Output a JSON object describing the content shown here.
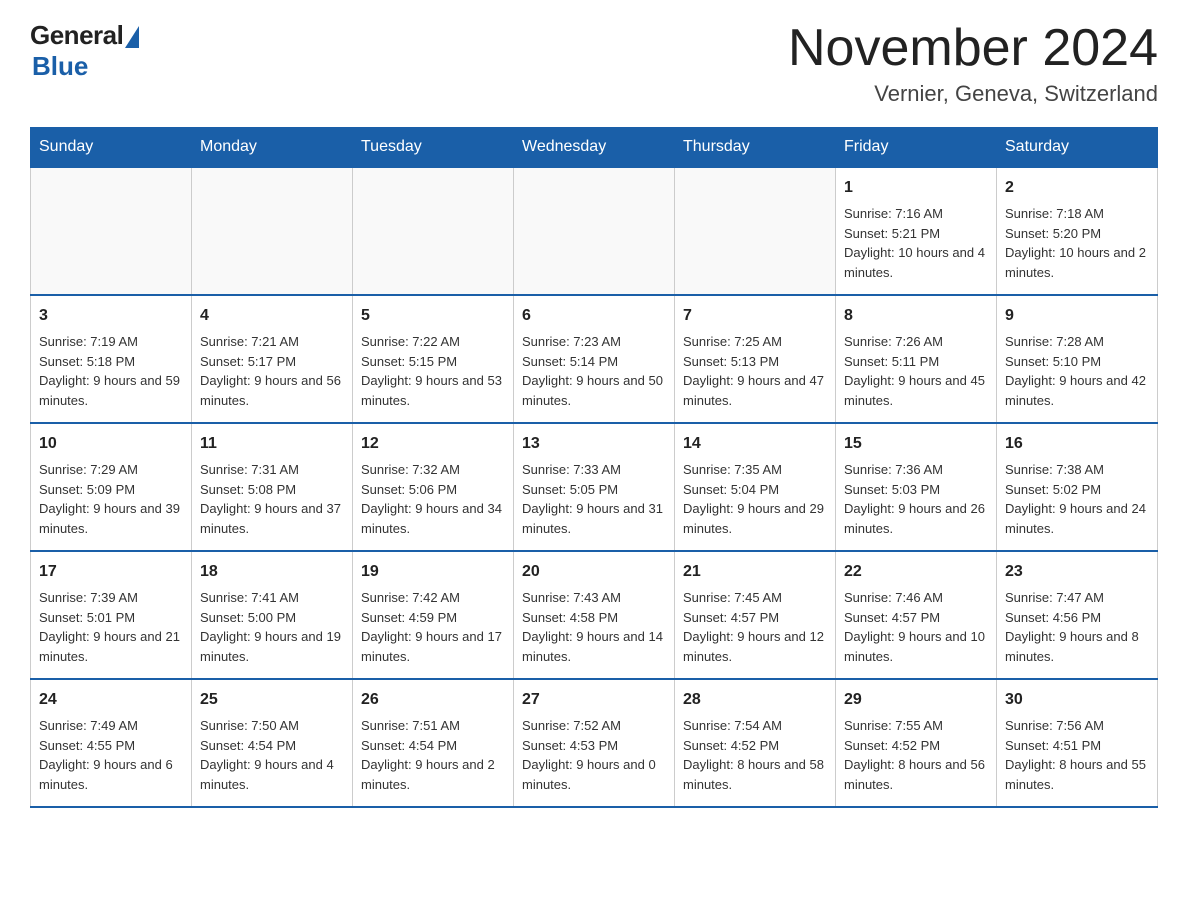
{
  "header": {
    "logo_general": "General",
    "logo_blue": "Blue",
    "title": "November 2024",
    "subtitle": "Vernier, Geneva, Switzerland"
  },
  "days_of_week": [
    "Sunday",
    "Monday",
    "Tuesday",
    "Wednesday",
    "Thursday",
    "Friday",
    "Saturday"
  ],
  "weeks": [
    [
      {
        "day": "",
        "info": ""
      },
      {
        "day": "",
        "info": ""
      },
      {
        "day": "",
        "info": ""
      },
      {
        "day": "",
        "info": ""
      },
      {
        "day": "",
        "info": ""
      },
      {
        "day": "1",
        "info": "Sunrise: 7:16 AM\nSunset: 5:21 PM\nDaylight: 10 hours and 4 minutes."
      },
      {
        "day": "2",
        "info": "Sunrise: 7:18 AM\nSunset: 5:20 PM\nDaylight: 10 hours and 2 minutes."
      }
    ],
    [
      {
        "day": "3",
        "info": "Sunrise: 7:19 AM\nSunset: 5:18 PM\nDaylight: 9 hours and 59 minutes."
      },
      {
        "day": "4",
        "info": "Sunrise: 7:21 AM\nSunset: 5:17 PM\nDaylight: 9 hours and 56 minutes."
      },
      {
        "day": "5",
        "info": "Sunrise: 7:22 AM\nSunset: 5:15 PM\nDaylight: 9 hours and 53 minutes."
      },
      {
        "day": "6",
        "info": "Sunrise: 7:23 AM\nSunset: 5:14 PM\nDaylight: 9 hours and 50 minutes."
      },
      {
        "day": "7",
        "info": "Sunrise: 7:25 AM\nSunset: 5:13 PM\nDaylight: 9 hours and 47 minutes."
      },
      {
        "day": "8",
        "info": "Sunrise: 7:26 AM\nSunset: 5:11 PM\nDaylight: 9 hours and 45 minutes."
      },
      {
        "day": "9",
        "info": "Sunrise: 7:28 AM\nSunset: 5:10 PM\nDaylight: 9 hours and 42 minutes."
      }
    ],
    [
      {
        "day": "10",
        "info": "Sunrise: 7:29 AM\nSunset: 5:09 PM\nDaylight: 9 hours and 39 minutes."
      },
      {
        "day": "11",
        "info": "Sunrise: 7:31 AM\nSunset: 5:08 PM\nDaylight: 9 hours and 37 minutes."
      },
      {
        "day": "12",
        "info": "Sunrise: 7:32 AM\nSunset: 5:06 PM\nDaylight: 9 hours and 34 minutes."
      },
      {
        "day": "13",
        "info": "Sunrise: 7:33 AM\nSunset: 5:05 PM\nDaylight: 9 hours and 31 minutes."
      },
      {
        "day": "14",
        "info": "Sunrise: 7:35 AM\nSunset: 5:04 PM\nDaylight: 9 hours and 29 minutes."
      },
      {
        "day": "15",
        "info": "Sunrise: 7:36 AM\nSunset: 5:03 PM\nDaylight: 9 hours and 26 minutes."
      },
      {
        "day": "16",
        "info": "Sunrise: 7:38 AM\nSunset: 5:02 PM\nDaylight: 9 hours and 24 minutes."
      }
    ],
    [
      {
        "day": "17",
        "info": "Sunrise: 7:39 AM\nSunset: 5:01 PM\nDaylight: 9 hours and 21 minutes."
      },
      {
        "day": "18",
        "info": "Sunrise: 7:41 AM\nSunset: 5:00 PM\nDaylight: 9 hours and 19 minutes."
      },
      {
        "day": "19",
        "info": "Sunrise: 7:42 AM\nSunset: 4:59 PM\nDaylight: 9 hours and 17 minutes."
      },
      {
        "day": "20",
        "info": "Sunrise: 7:43 AM\nSunset: 4:58 PM\nDaylight: 9 hours and 14 minutes."
      },
      {
        "day": "21",
        "info": "Sunrise: 7:45 AM\nSunset: 4:57 PM\nDaylight: 9 hours and 12 minutes."
      },
      {
        "day": "22",
        "info": "Sunrise: 7:46 AM\nSunset: 4:57 PM\nDaylight: 9 hours and 10 minutes."
      },
      {
        "day": "23",
        "info": "Sunrise: 7:47 AM\nSunset: 4:56 PM\nDaylight: 9 hours and 8 minutes."
      }
    ],
    [
      {
        "day": "24",
        "info": "Sunrise: 7:49 AM\nSunset: 4:55 PM\nDaylight: 9 hours and 6 minutes."
      },
      {
        "day": "25",
        "info": "Sunrise: 7:50 AM\nSunset: 4:54 PM\nDaylight: 9 hours and 4 minutes."
      },
      {
        "day": "26",
        "info": "Sunrise: 7:51 AM\nSunset: 4:54 PM\nDaylight: 9 hours and 2 minutes."
      },
      {
        "day": "27",
        "info": "Sunrise: 7:52 AM\nSunset: 4:53 PM\nDaylight: 9 hours and 0 minutes."
      },
      {
        "day": "28",
        "info": "Sunrise: 7:54 AM\nSunset: 4:52 PM\nDaylight: 8 hours and 58 minutes."
      },
      {
        "day": "29",
        "info": "Sunrise: 7:55 AM\nSunset: 4:52 PM\nDaylight: 8 hours and 56 minutes."
      },
      {
        "day": "30",
        "info": "Sunrise: 7:56 AM\nSunset: 4:51 PM\nDaylight: 8 hours and 55 minutes."
      }
    ]
  ]
}
